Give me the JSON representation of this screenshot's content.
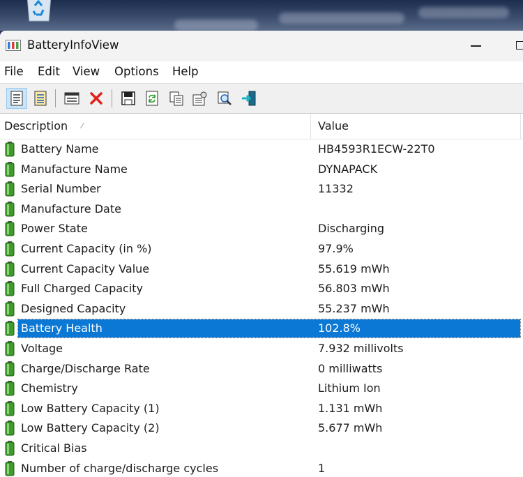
{
  "window": {
    "title": "BatteryInfoView"
  },
  "menu": [
    "File",
    "Edit",
    "View",
    "Options",
    "Help"
  ],
  "toolbar": {
    "icons": [
      "advanced-report-icon",
      "properties-list-icon",
      "html-report-icon",
      "delete-icon",
      "save-icon",
      "refresh-icon",
      "copy-icon",
      "properties-icon",
      "find-icon",
      "exit-icon"
    ]
  },
  "columns": {
    "description": "Description",
    "value": "Value",
    "sort_indicator": "⁄"
  },
  "rows": [
    {
      "description": "Battery Name",
      "value": "HB4593R1ECW-22T0"
    },
    {
      "description": "Manufacture Name",
      "value": "DYNAPACK"
    },
    {
      "description": "Serial Number",
      "value": "11332"
    },
    {
      "description": "Manufacture Date",
      "value": ""
    },
    {
      "description": "Power State",
      "value": "Discharging"
    },
    {
      "description": "Current Capacity (in %)",
      "value": "97.9%"
    },
    {
      "description": "Current Capacity Value",
      "value": "55.619 mWh"
    },
    {
      "description": "Full Charged Capacity",
      "value": "56.803 mWh"
    },
    {
      "description": "Designed Capacity",
      "value": "55.237 mWh"
    },
    {
      "description": "Battery Health",
      "value": "102.8%",
      "selected": true
    },
    {
      "description": "Voltage",
      "value": "7.932 millivolts"
    },
    {
      "description": "Charge/Discharge Rate",
      "value": "0 milliwatts"
    },
    {
      "description": "Chemistry",
      "value": "Lithium Ion"
    },
    {
      "description": "Low Battery Capacity (1)",
      "value": "1.131 mWh"
    },
    {
      "description": "Low Battery Capacity (2)",
      "value": "5.677 mWh"
    },
    {
      "description": "Critical Bias",
      "value": ""
    },
    {
      "description": "Number of charge/discharge cycles",
      "value": "1"
    }
  ],
  "colors": {
    "selection": "#0a78d4",
    "battery_green": "#3e9b2c",
    "toolbar_bg": "#f0f0f0",
    "titlebar_bg": "#f3f3f3"
  }
}
